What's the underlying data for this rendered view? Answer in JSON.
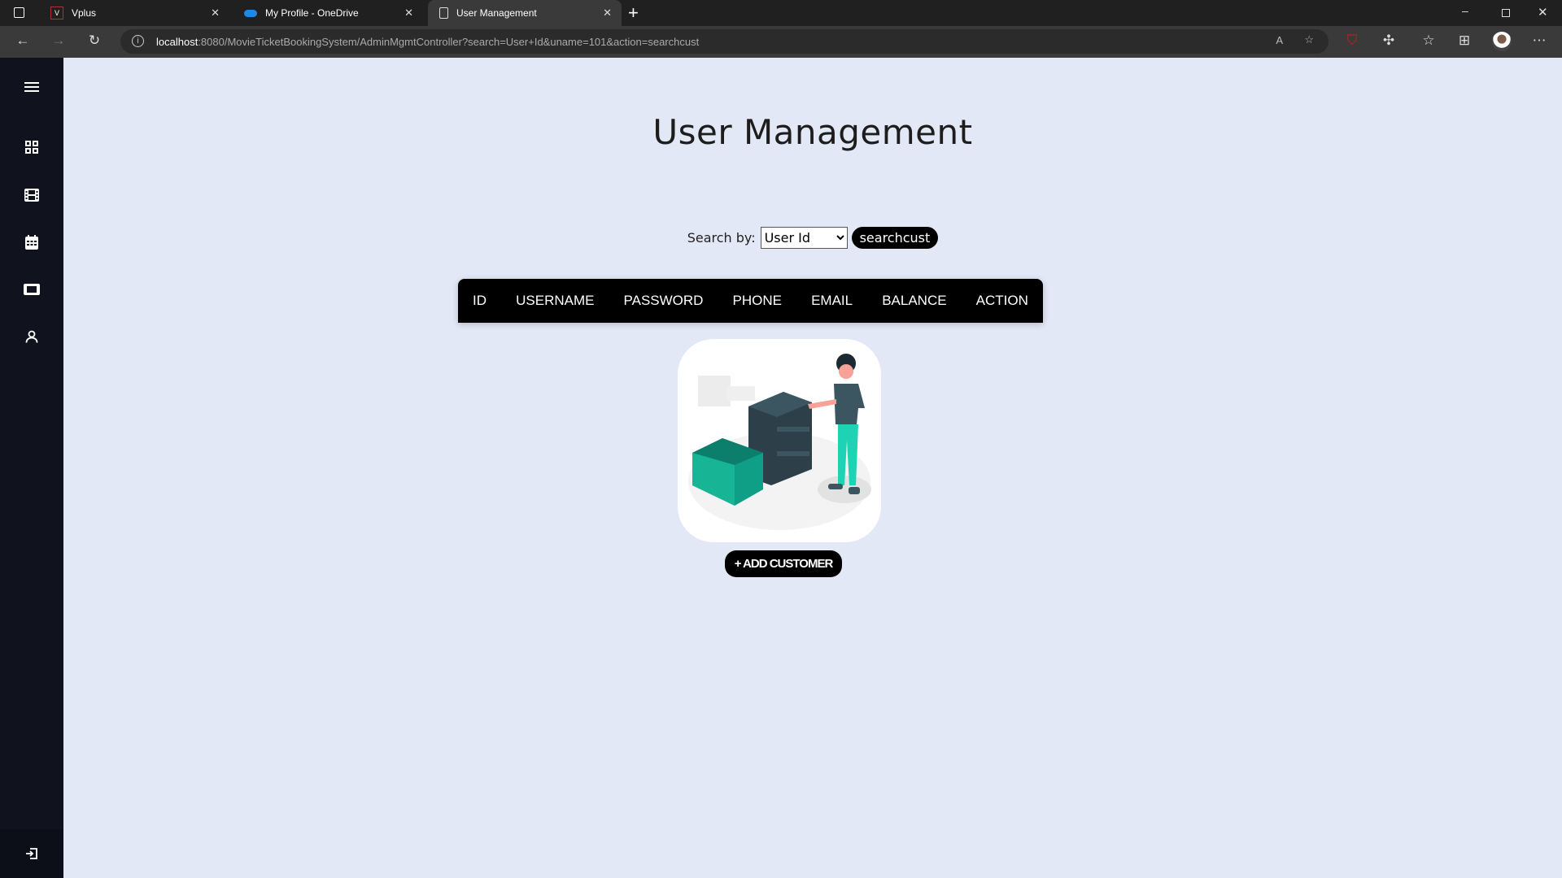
{
  "browser": {
    "tabs": [
      {
        "title": "Vplus"
      },
      {
        "title": "My Profile - OneDrive"
      },
      {
        "title": "User Management"
      }
    ],
    "url_host": "localhost",
    "url_rest": ":8080/MovieTicketBookingSystem/AdminMgmtController?search=User+Id&uname=101&action=searchcust"
  },
  "sidebar": {
    "items": [
      "menu-icon",
      "dashboard-icon",
      "film-icon",
      "calendar-icon",
      "ticket-icon",
      "user-icon"
    ],
    "logout": "logout-icon"
  },
  "page": {
    "title": "User Management",
    "search_label": "Search by:",
    "search_select_value": "User Id",
    "search_button": "searchcust",
    "columns": [
      "ID",
      "USERNAME",
      "PASSWORD",
      "PHONE",
      "EMAIL",
      "BALANCE",
      "ACTION"
    ],
    "add_button": "+ ADD CUSTOMER"
  }
}
